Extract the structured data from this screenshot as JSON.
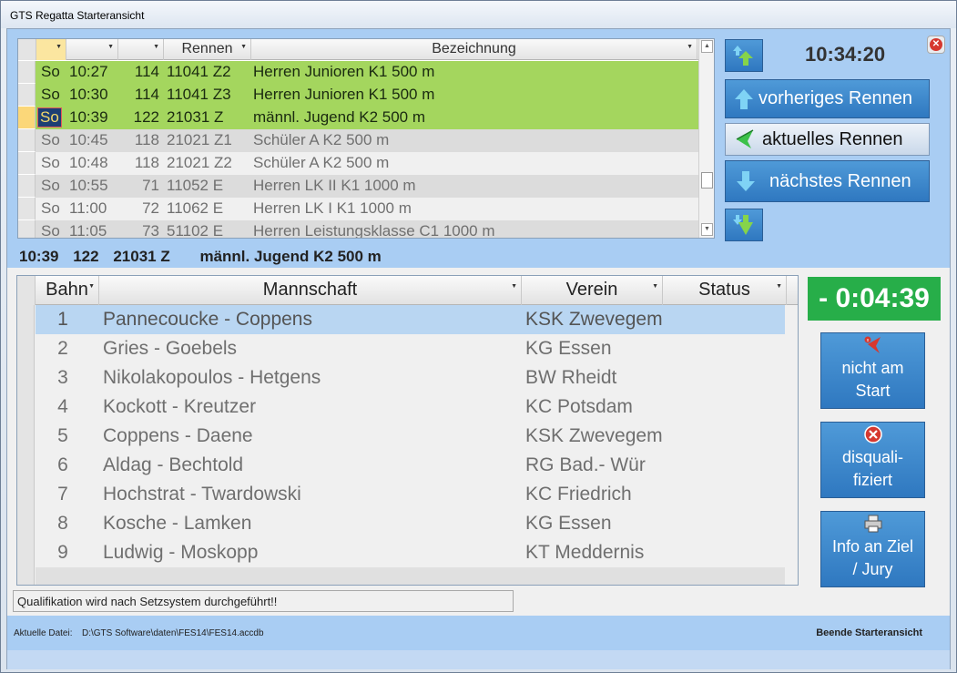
{
  "window": {
    "title": "GTS Regatta Starteransicht"
  },
  "clock": "10:34:20",
  "buttons": {
    "previous": "vorheriges Rennen",
    "current": "aktuelles Rennen",
    "next": "nächstes Rennen"
  },
  "races_grid": {
    "headers": [
      "",
      "",
      "Rennen",
      "Bezeichnung"
    ],
    "rows": [
      {
        "day": "So",
        "time": "10:27",
        "num": "114",
        "race": "11041 Z2",
        "name": "Herren Junioren  K1  500 m",
        "state": "green"
      },
      {
        "day": "So",
        "time": "10:30",
        "num": "114",
        "race": "11041 Z3",
        "name": "Herren Junioren  K1  500 m",
        "state": "green"
      },
      {
        "day": "So",
        "time": "10:39",
        "num": "122",
        "race": "21031 Z",
        "name": "männl. Jugend  K2  500 m",
        "state": "green"
      },
      {
        "day": "So",
        "time": "10:45",
        "num": "118",
        "race": "21021 Z1",
        "name": "Schüler A  K2  500 m",
        "state": "grey"
      },
      {
        "day": "So",
        "time": "10:48",
        "num": "118",
        "race": "21021 Z2",
        "name": "Schüler A  K2  500 m",
        "state": "light"
      },
      {
        "day": "So",
        "time": "10:55",
        "num": "71",
        "race": "11052 E",
        "name": "Herren LK II  K1  1000 m",
        "state": "grey"
      },
      {
        "day": "So",
        "time": "11:00",
        "num": "72",
        "race": "11062 E",
        "name": "Herren LK I  K1  1000 m",
        "state": "light"
      },
      {
        "day": "So",
        "time": "11:05",
        "num": "73",
        "race": "51102 E",
        "name": "Herren Leistungsklasse  C1  1000 m",
        "state": "grey"
      }
    ]
  },
  "current_race": {
    "time": "10:39",
    "num": "122",
    "race": "21031 Z",
    "name": "männl. Jugend  K2  500 m"
  },
  "crews_grid": {
    "headers": {
      "lane": "Bahn",
      "crew": "Mannschaft",
      "club": "Verein",
      "status": "Status"
    },
    "rows": [
      {
        "lane": "1",
        "crew": "Pannecoucke - Coppens",
        "club": "KSK Zwevegem",
        "status": ""
      },
      {
        "lane": "2",
        "crew": "Gries - Goebels",
        "club": "KG Essen",
        "status": ""
      },
      {
        "lane": "3",
        "crew": "Nikolakopoulos - Hetgens",
        "club": "BW Rheidt",
        "status": ""
      },
      {
        "lane": "4",
        "crew": "Kockott - Kreutzer",
        "club": "KC Potsdam",
        "status": ""
      },
      {
        "lane": "5",
        "crew": "Coppens - Daene",
        "club": "KSK Zwevegem",
        "status": ""
      },
      {
        "lane": "6",
        "crew": "Aldag - Bechtold",
        "club": "RG Bad.- Wür",
        "status": ""
      },
      {
        "lane": "7",
        "crew": "Hochstrat - Twardowski",
        "club": "KC Friedrich",
        "status": ""
      },
      {
        "lane": "8",
        "crew": "Kosche - Lamken",
        "club": "KG Essen",
        "status": ""
      },
      {
        "lane": "9",
        "crew": "Ludwig - Moskopp",
        "club": "KT Meddernis",
        "status": ""
      }
    ]
  },
  "countdown": "- 0:04:39",
  "actions": {
    "dns": [
      "nicht am",
      "Start"
    ],
    "dsq": [
      "disquali-",
      "fiziert"
    ],
    "info": [
      "Info an Ziel",
      "/ Jury"
    ]
  },
  "message": "Qualifikation wird nach Setzsystem durchgeführt!!",
  "footer": {
    "file_label": "Aktuelle Datei:",
    "file_path": "D:\\GTS Software\\daten\\FES14\\FES14.accdb",
    "exit": "Beende Starteransicht"
  },
  "colors": {
    "accent_blue": "#2f78c0",
    "green_row": "#a4d65e",
    "timer_green": "#27ae49",
    "panel_blue": "#a9cdf3"
  }
}
